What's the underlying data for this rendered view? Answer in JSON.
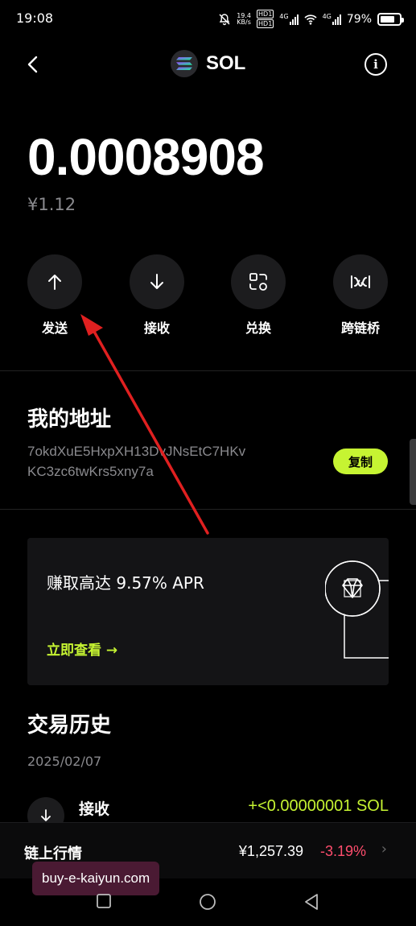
{
  "status": {
    "time": "19:08",
    "net_speed_value": "19.4",
    "net_speed_unit": "KB/s",
    "hd1": "HD1",
    "hd2": "HD1",
    "net1": "4G",
    "net2": "4G",
    "battery": "79%",
    "battery_level": 0.79
  },
  "header": {
    "title": "SOL",
    "back_icon": "chevron-left-icon",
    "info_icon": "info-icon"
  },
  "balance": {
    "amount": "0.0008908",
    "fiat": "¥1.12"
  },
  "actions": [
    {
      "label": "发送",
      "icon": "arrow-up-icon"
    },
    {
      "label": "接收",
      "icon": "arrow-down-icon"
    },
    {
      "label": "兑换",
      "icon": "swap-grid-icon"
    },
    {
      "label": "跨链桥",
      "icon": "bridge-icon"
    }
  ],
  "address": {
    "title": "我的地址",
    "line1": "7okdXuE5HxpXH13DvJNsEtC7HKv",
    "line2": "KC3zc6twKrs5xny7a",
    "copy_label": "复制"
  },
  "promo": {
    "title": "赚取高达 9.57% APR",
    "link": "立即查看 →"
  },
  "history": {
    "title": "交易历史",
    "date": "2025/02/07",
    "items": [
      {
        "type": "接收",
        "amount": "+<0.00000001 SOL"
      }
    ]
  },
  "market": {
    "label": "链上行情",
    "price": "¥1,257.39",
    "change": "-3.19%",
    "chevron": "›"
  },
  "watermark": "buy-e-kaiyun.com",
  "colors": {
    "accent": "#c6f432",
    "negative": "#ff4d6d",
    "annotation": "#e02020"
  }
}
